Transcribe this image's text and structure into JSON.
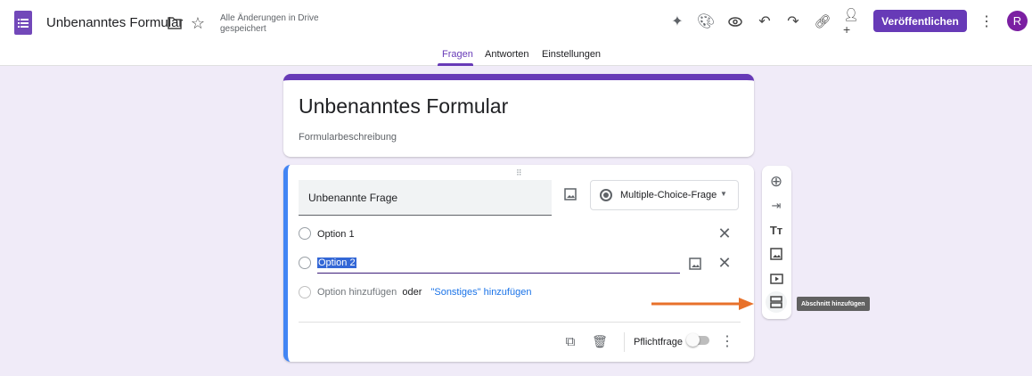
{
  "header": {
    "title": "Unbenanntes Formular",
    "save_status_line1": "Alle Änderungen in Drive",
    "save_status_line2": "gespeichert",
    "publish_label": "Veröffentlichen",
    "avatar_letter": "R"
  },
  "tabs": [
    {
      "label": "Fragen",
      "active": true
    },
    {
      "label": "Antworten"
    },
    {
      "label": "Einstellungen"
    }
  ],
  "form": {
    "title": "Unbenanntes Formular",
    "description": "Formularbeschreibung"
  },
  "question": {
    "title": "Unbenannte Frage",
    "type": "Multiple-Choice-Frage",
    "options": [
      "Option 1",
      "Option 2"
    ],
    "add_option": "Option hinzufügen",
    "or": "oder",
    "add_other": "\"Sonstiges\" hinzufügen",
    "required_label": "Pflichtfrage",
    "required": false
  },
  "tooltip": "Abschnitt hinzufügen",
  "colors": {
    "accent": "#673ab7",
    "blue": "#4285f4",
    "arrow": "#e8712b",
    "bg": "#f0ebf8"
  }
}
